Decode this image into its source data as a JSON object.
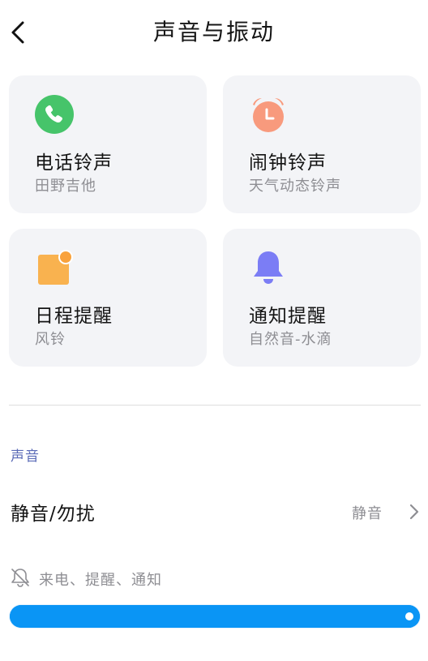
{
  "header": {
    "title": "声音与振动",
    "back_icon": "chevron-left-icon"
  },
  "cards": [
    {
      "id": "phone-ringtone",
      "name": "电话铃声",
      "value": "田野吉他",
      "icon": "phone-icon",
      "color": "#46c46a"
    },
    {
      "id": "alarm-ringtone",
      "name": "闹钟铃声",
      "value": "天气动态铃声",
      "icon": "alarm-clock-icon",
      "color": "#f89a7d"
    },
    {
      "id": "calendar-reminder",
      "name": "日程提醒",
      "value": "风铃",
      "icon": "calendar-note-icon",
      "color": "#f9b24f"
    },
    {
      "id": "notification-reminder",
      "name": "通知提醒",
      "value": "自然音-水滴",
      "icon": "bell-icon",
      "color": "#7b7df5"
    }
  ],
  "sound_section": {
    "label": "声音",
    "mute_row": {
      "title": "静音/勿扰",
      "value": "静音"
    },
    "volume": {
      "caption": "来电、提醒、通知",
      "icon": "bell-muted-icon",
      "level": 1.0
    }
  },
  "colors": {
    "accent": "#0a95f5",
    "section_label": "#5b6bb7"
  }
}
